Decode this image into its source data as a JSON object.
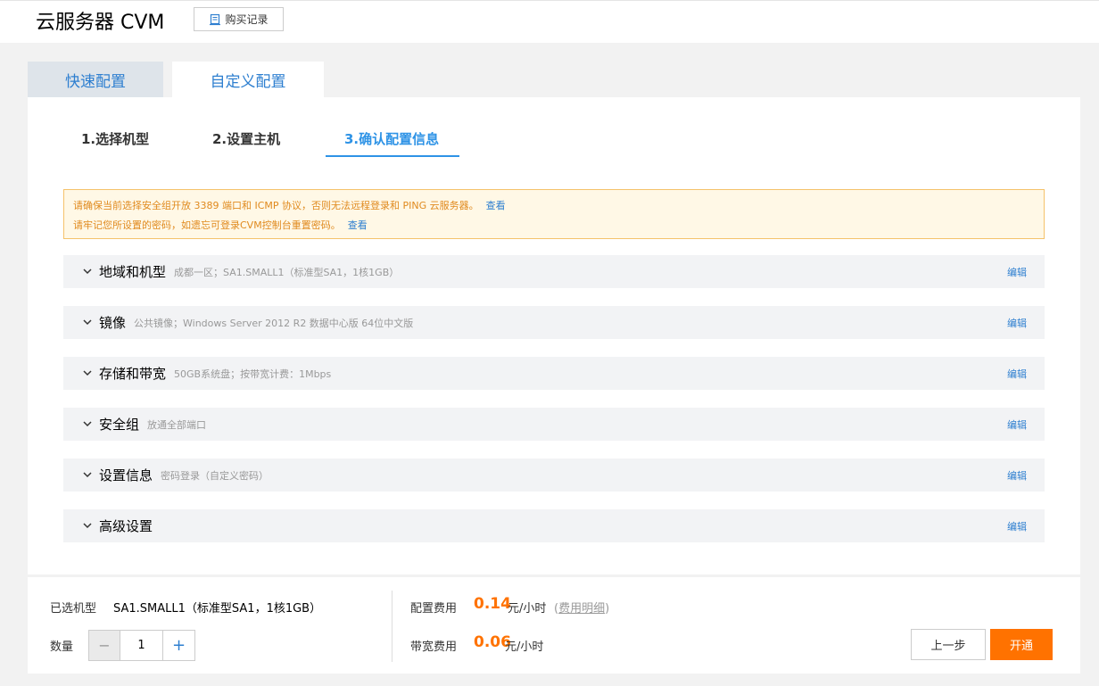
{
  "header": {
    "title": "云服务器 CVM",
    "purchase_records": "购买记录"
  },
  "tabs": [
    {
      "label": "快速配置"
    },
    {
      "label": "自定义配置"
    }
  ],
  "steps": [
    {
      "label": "1.选择机型"
    },
    {
      "label": "2.设置主机"
    },
    {
      "label": "3.确认配置信息",
      "active": true
    }
  ],
  "warning": {
    "line1": "请确保当前选择安全组开放 3389 端口和 ICMP 协议，否则无法远程登录和 PING 云服务器。",
    "line1_link": "查看",
    "line2": "请牢记您所设置的密码，如遗忘可登录CVM控制台重置密码。",
    "line2_link": "查看"
  },
  "sections": [
    {
      "title": "地域和机型",
      "desc": "成都一区；SA1.SMALL1（标准型SA1，1核1GB）",
      "edit": "编辑"
    },
    {
      "title": "镜像",
      "desc": "公共镜像；Windows Server 2012 R2 数据中心版 64位中文版",
      "edit": "编辑"
    },
    {
      "title": "存储和带宽",
      "desc": "50GB系统盘；按带宽计费：1Mbps",
      "edit": "编辑"
    },
    {
      "title": "安全组",
      "desc": "放通全部端口",
      "edit": "编辑"
    },
    {
      "title": "设置信息",
      "desc": "密码登录（自定义密码）",
      "edit": "编辑"
    },
    {
      "title": "高级设置",
      "desc": "",
      "edit": "编辑"
    }
  ],
  "footer": {
    "model_label": "已选机型",
    "model_value": "SA1.SMALL1（标准型SA1，1核1GB）",
    "qty_label": "数量",
    "qty_minus": "−",
    "qty_value": "1",
    "qty_plus": "+",
    "config_fee_label": "配置费用",
    "config_fee_price": "0.14",
    "config_fee_unit": "元/小时",
    "fee_detail_open": "(",
    "fee_detail": "费用明细",
    "fee_detail_close": ")",
    "bw_fee_label": "带宽费用",
    "bw_fee_price": "0.06",
    "bw_fee_unit": "元/小时",
    "prev_button": "上一步",
    "open_button": "开通"
  },
  "colors": {
    "accent_blue": "#2e93e6",
    "link_blue": "#2e7fd0",
    "price_orange": "#ff7200",
    "warning_bg": "#fff8e6",
    "warning_border": "#f5c26b"
  },
  "icons": {
    "purchase_records": "document-icon",
    "section_toggle": "chevron-down-icon"
  }
}
